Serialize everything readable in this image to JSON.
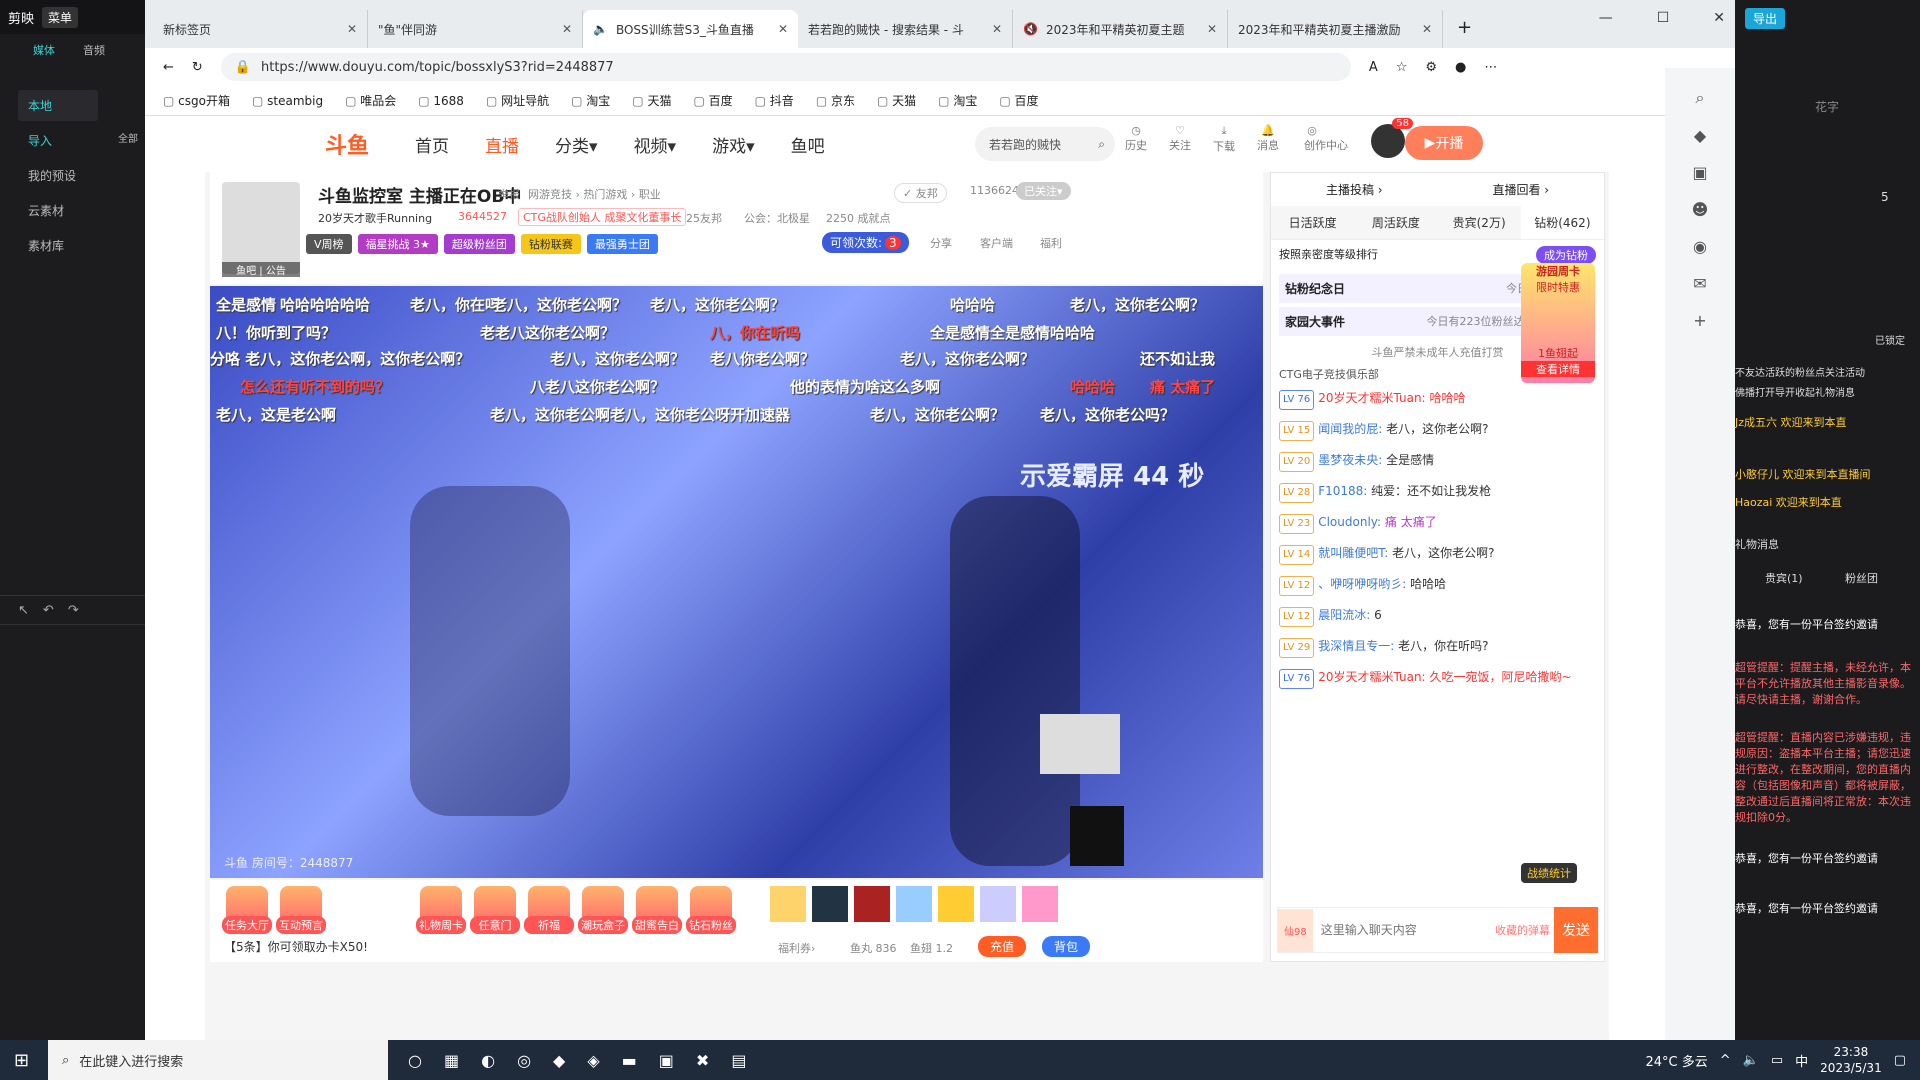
{
  "jianying": {
    "app": "剪映",
    "menu": "菜单",
    "tabs": [
      "媒体",
      "音频"
    ],
    "side": [
      "本地",
      "导入",
      "我的预设",
      "云素材",
      "素材库"
    ],
    "all": "全部"
  },
  "browser": {
    "tabs": [
      "新标签页",
      "\"鱼\"伴同游",
      "BOSS训练营S3_斗鱼直播",
      "若若跑的贼快 - 搜索结果 - 斗",
      "2023年和平精英初夏主题",
      "2023年和平精英初夏主播激励"
    ],
    "url": "https://www.douyu.com/topic/bossxlyS3?rid=2448877",
    "bookmarks": [
      "csgo开箱",
      "steambig",
      "唯品会",
      "1688",
      "网址导航",
      "淘宝",
      "天猫",
      "百度",
      "抖音",
      "京东",
      "天猫",
      "淘宝",
      "百度"
    ]
  },
  "site": {
    "logo": "斗鱼",
    "nav": [
      "首页",
      "直播",
      "分类▾",
      "视频▾",
      "游戏▾",
      "鱼吧"
    ],
    "search": "若若跑的贼快",
    "tools": [
      "历史",
      "关注",
      "下载",
      "消息",
      "创作中心"
    ],
    "badge": "58",
    "golive": "开播"
  },
  "room": {
    "title": "斗鱼监控室 主播正在OB中",
    "report": "举报",
    "category": "网游竞技 › 热门游戏 › 职业",
    "follow": "✓ 友邦",
    "followers": "1136624",
    "followed": "已关注▾",
    "anchor": "20岁天才歌手Running",
    "hot": "3644527",
    "ctg": "CTG战队创始人 成聚文化董事长",
    "friends": "25友邦",
    "guild": "公会：北极星",
    "ach": "2250 成就点",
    "tags": [
      "V周榜",
      "福星挑战 3★",
      "超级粉丝团",
      "钻粉联赛",
      "最强勇士团"
    ],
    "claim": "可领次数:",
    "claim_n": "3",
    "share": "分享",
    "client": "客户端",
    "welfare": "福利",
    "fishbar": "鱼吧 | 公告",
    "roomid": "斗鱼 房间号：2448877",
    "banner": "示爱霸屏 44 秒"
  },
  "danmaku": [
    "全是感情",
    "哈哈哈哈哈哈",
    "老八，你在吗",
    "老八，这你老公啊？",
    "老八，这你老公啊？",
    "哈哈哈",
    "老八，这你老公啊？",
    "八！你听到了吗？",
    "老老八这你老公啊？",
    "八，你在听吗",
    "全是感情全是感情哈哈哈",
    "分咯 老八，这你老公啊，这你老公啊？",
    "老八，这你老公啊？",
    "老八你老公啊？",
    "老八，这你老公啊？",
    "还不如让我",
    "怎么还有听不到的吗？",
    "八老八这你老公啊？",
    "他的表情为啥这么多啊",
    "哈哈哈",
    "痛 太痛了",
    "老八，这是老公啊",
    "老八，这你老公啊",
    "老八，这你老公呀开加速器",
    "老八，这你老公啊？",
    "老八，这你老公吗？"
  ],
  "gifts": [
    "任务大厅",
    "互动预言",
    "礼物周卡",
    "任意门",
    "祈福",
    "潮玩盒子",
    "甜蜜告白",
    "钻石粉丝"
  ],
  "giftbar": {
    "notice": "【5条】你可领取办卡X50!",
    "welfare": "福利券›",
    "fishball": "鱼丸 836",
    "fishfin": "鱼翅 1.2",
    "recharge": "充值",
    "bag": "背包"
  },
  "chat": {
    "top": [
      "主播投稿 ›",
      "直播回看 ›"
    ],
    "tabs": [
      "日活跃度",
      "周活跃度",
      "贵宾(2万)",
      "钻粉(462)"
    ],
    "rank": "按照亲密度等级排行",
    "become": "成为钻粉",
    "event1": "钻粉纪念日",
    "event1_sub": "今日共有7位粉丝",
    "event2": "家园大事件",
    "event2_sub": "今日有223位粉丝达成稀有成就...",
    "notice": "斗鱼严禁未成年人充值打赏",
    "club": "CTG电子竞技俱乐部",
    "promo": {
      "title": "游园周卡",
      "sub": "限时特惠",
      "price": "1鱼翅起",
      "detail": "查看详情"
    },
    "msgs": [
      {
        "lv": "LV 76",
        "name": "20岁天才糯米Tuan:",
        "text": "哈哈哈"
      },
      {
        "lv": "LV 15",
        "name": "闻闻我的屁:",
        "text": "老八，这你老公啊?"
      },
      {
        "lv": "LV 20",
        "name": "墨梦夜未央:",
        "text": "全是感情"
      },
      {
        "lv": "LV 28",
        "name": "F10188:",
        "text": "纯爱：还不如让我发枪"
      },
      {
        "lv": "LV 23",
        "name": "Cloudonly:",
        "text": "痛 太痛了"
      },
      {
        "lv": "LV 14",
        "name": "就叫雕便吧T:",
        "text": "老八，这你老公啊?"
      },
      {
        "lv": "LV 12",
        "name": "、咿呀咿呀哟彡:",
        "text": "哈哈哈"
      },
      {
        "lv": "LV 12",
        "name": "晨阳流冰:",
        "text": "6"
      },
      {
        "lv": "LV 29",
        "name": "我深情且专一:",
        "text": "老八，你在听吗?"
      },
      {
        "lv": "LV 76",
        "name": "20岁天才糯米Tuan:",
        "text": "久吃一宛饭，阿尼哈撒哟~"
      }
    ],
    "input_placeholder": "这里输入聊天内容",
    "collect": "收藏的弹幕",
    "send": "发送",
    "fan": "仙98",
    "stat": "战绩统计"
  },
  "right": {
    "export": "导出",
    "lines": [
      "花字",
      "5",
      "已锁定",
      "不友达活跃的粉丝点关注活动",
      "佛播打开导开收起礼物消息",
      "Jz成五六 欢迎来到本直",
      "小憨仔儿 欢迎来到本直播间",
      "Haozai 欢迎来到本直",
      "礼物消息",
      "贵宾(1)",
      "粉丝团",
      "恭喜，您有一份平台签约邀请",
      "超管提醒：提醒主播，未经允许，本平台不允许播放其他主播影音录像。请尽快请主播，谢谢合作。",
      "超管提醒：直播内容已涉嫌违规，违规原因：盗播本平台主播；请您迅速进行整改，在整改期间，您的直播内容（包括图像和声音）都将被屏蔽，整改通过后直播间将正常放：本次违规扣除0分。",
      "恭喜，您有一份平台签约邀请",
      "恭喜，您有一份平台签约邀请"
    ]
  },
  "taskbar": {
    "search": "在此键入进行搜索",
    "weather": "24°C 多云",
    "ime": "中",
    "time": "23:38",
    "date": "2023/5/31"
  }
}
